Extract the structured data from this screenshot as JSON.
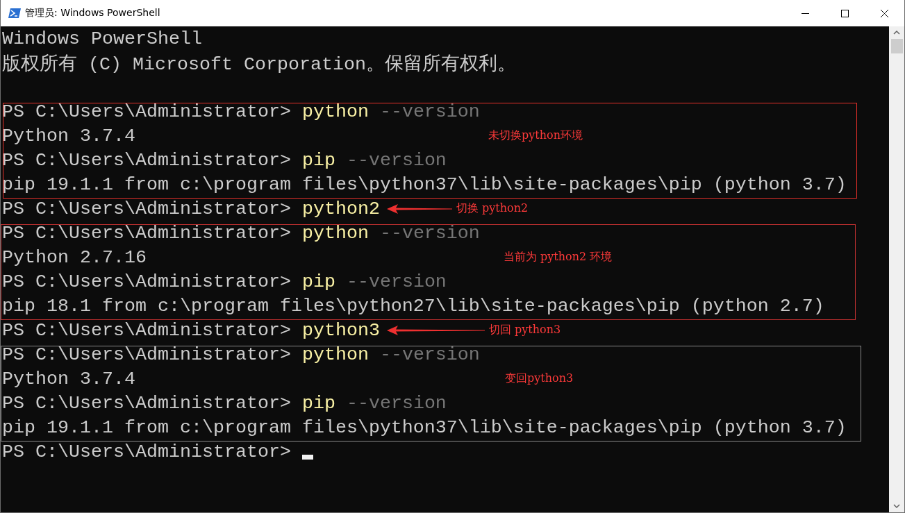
{
  "window": {
    "title": "管理员: Windows PowerShell"
  },
  "terminal": {
    "lines": [
      {
        "kind": "text",
        "segments": [
          {
            "kind": "output",
            "text": "Windows PowerShell"
          }
        ]
      },
      {
        "kind": "text",
        "segments": [
          {
            "kind": "output",
            "text": "版权所有 (C) Microsoft Corporation。保留所有权利。"
          }
        ]
      },
      {
        "kind": "blank"
      },
      {
        "kind": "text",
        "segments": [
          {
            "kind": "prompt",
            "text": "PS C:\\Users\\Administrator> "
          },
          {
            "kind": "command",
            "text": "python"
          },
          {
            "kind": "param",
            "text": " --version"
          }
        ]
      },
      {
        "kind": "text",
        "segments": [
          {
            "kind": "output",
            "text": "Python 3.7.4"
          }
        ]
      },
      {
        "kind": "text",
        "segments": [
          {
            "kind": "prompt",
            "text": "PS C:\\Users\\Administrator> "
          },
          {
            "kind": "command",
            "text": "pip"
          },
          {
            "kind": "param",
            "text": " --version"
          }
        ]
      },
      {
        "kind": "text",
        "segments": [
          {
            "kind": "output",
            "text": "pip 19.1.1 from c:\\program files\\python37\\lib\\site-packages\\pip (python 3.7)"
          }
        ]
      },
      {
        "kind": "text",
        "segments": [
          {
            "kind": "prompt",
            "text": "PS C:\\Users\\Administrator> "
          },
          {
            "kind": "command",
            "text": "python2"
          }
        ]
      },
      {
        "kind": "text",
        "segments": [
          {
            "kind": "prompt",
            "text": "PS C:\\Users\\Administrator> "
          },
          {
            "kind": "command",
            "text": "python"
          },
          {
            "kind": "param",
            "text": " --version"
          }
        ]
      },
      {
        "kind": "text",
        "segments": [
          {
            "kind": "output",
            "text": "Python 2.7.16"
          }
        ]
      },
      {
        "kind": "text",
        "segments": [
          {
            "kind": "prompt",
            "text": "PS C:\\Users\\Administrator> "
          },
          {
            "kind": "command",
            "text": "pip"
          },
          {
            "kind": "param",
            "text": " --version"
          }
        ]
      },
      {
        "kind": "text",
        "segments": [
          {
            "kind": "output",
            "text": "pip 18.1 from c:\\program files\\python27\\lib\\site-packages\\pip (python 2.7)"
          }
        ]
      },
      {
        "kind": "text",
        "segments": [
          {
            "kind": "prompt",
            "text": "PS C:\\Users\\Administrator> "
          },
          {
            "kind": "command",
            "text": "python3"
          }
        ]
      },
      {
        "kind": "text",
        "segments": [
          {
            "kind": "prompt",
            "text": "PS C:\\Users\\Administrator> "
          },
          {
            "kind": "command",
            "text": "python"
          },
          {
            "kind": "param",
            "text": " --version"
          }
        ]
      },
      {
        "kind": "text",
        "segments": [
          {
            "kind": "output",
            "text": "Python 3.7.4"
          }
        ]
      },
      {
        "kind": "text",
        "segments": [
          {
            "kind": "prompt",
            "text": "PS C:\\Users\\Administrator> "
          },
          {
            "kind": "command",
            "text": "pip"
          },
          {
            "kind": "param",
            "text": " --version"
          }
        ]
      },
      {
        "kind": "text",
        "segments": [
          {
            "kind": "output",
            "text": "pip 19.1.1 from c:\\program files\\python37\\lib\\site-packages\\pip (python 3.7)"
          }
        ]
      },
      {
        "kind": "text",
        "segments": [
          {
            "kind": "prompt",
            "text": "PS C:\\Users\\Administrator> "
          }
        ],
        "cursor": true
      }
    ]
  },
  "annotations": {
    "boxes": [
      {
        "color": "#e8302a"
      },
      {
        "color": "#c03030"
      },
      {
        "color": "#8a8a8a"
      }
    ],
    "notes": [
      {
        "text": "未切换python环境",
        "arrow": false
      },
      {
        "text": "切换 python2",
        "arrow": true
      },
      {
        "text": "当前为 python2 环境",
        "arrow": false
      },
      {
        "text": "切回 python3",
        "arrow": true
      },
      {
        "text": "变回python3",
        "arrow": false
      }
    ]
  }
}
